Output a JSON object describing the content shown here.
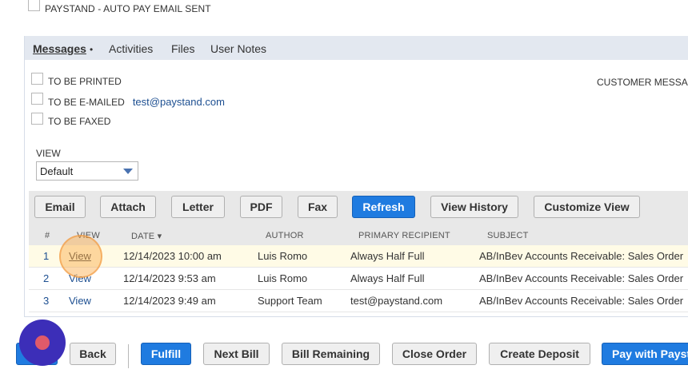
{
  "top_option": {
    "label": "PAYSTAND - AUTO PAY EMAIL SENT"
  },
  "tabs": [
    {
      "label": "Messages",
      "active": true,
      "marker": "•"
    },
    {
      "label": "Activities"
    },
    {
      "label": "Files"
    },
    {
      "label": "User Notes"
    }
  ],
  "options": {
    "to_be_printed": "TO BE PRINTED",
    "to_be_emailed": "TO BE E-MAILED",
    "email": "test@paystand.com",
    "to_be_faxed": "TO BE FAXED",
    "customer_message": "CUSTOMER MESSAG"
  },
  "view": {
    "label": "VIEW",
    "selected": "Default"
  },
  "toolbar": [
    "Email",
    "Attach",
    "Letter",
    "PDF",
    "Fax",
    "Refresh",
    "View History",
    "Customize View"
  ],
  "table": {
    "headers": [
      "#",
      "VIEW",
      "DATE ▾",
      "AUTHOR",
      "PRIMARY RECIPIENT",
      "SUBJECT"
    ],
    "rows": [
      {
        "num": "1",
        "view": "View",
        "date": "12/14/2023 10:00 am",
        "author": "Luis Romo",
        "recipient": "Always Half Full",
        "subject": "AB/InBev Accounts Receivable: Sales Order"
      },
      {
        "num": "2",
        "view": "View",
        "date": "12/14/2023 9:53 am",
        "author": "Luis Romo",
        "recipient": "Always Half Full",
        "subject": "AB/InBev Accounts Receivable: Sales Order"
      },
      {
        "num": "3",
        "view": "View",
        "date": "12/14/2023 9:49 am",
        "author": "Support Team",
        "recipient": "test@paystand.com",
        "subject": "AB/InBev Accounts Receivable: Sales Order"
      }
    ]
  },
  "bottom_buttons": [
    "Back",
    "Fulfill",
    "Next Bill",
    "Bill Remaining",
    "Close Order",
    "Create Deposit",
    "Pay with Payst"
  ],
  "colors": {
    "primary": "#1f7be0",
    "link": "#1d4f91",
    "tabbar": "#e3e8f0",
    "record_button": "#3c2eb8"
  }
}
